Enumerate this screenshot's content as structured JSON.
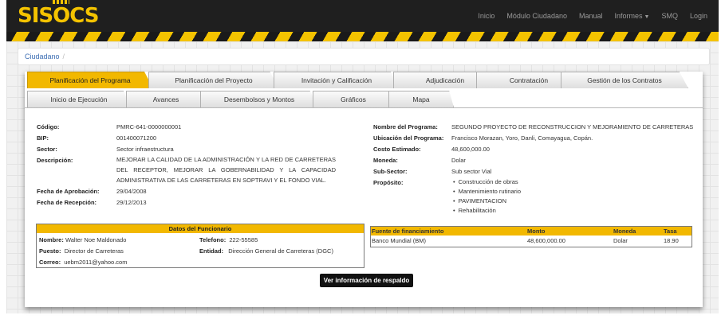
{
  "brand": {
    "logo": "SISOCS"
  },
  "nav": {
    "items": [
      "Inicio",
      "Módulo Ciudadano",
      "Manual",
      "Informes",
      "SMQ",
      "Login"
    ]
  },
  "breadcrumb": {
    "link": "Ciudadano",
    "separator": "/"
  },
  "tabs": {
    "row1": [
      "Planificación del Programa",
      "Planificación del Proyecto",
      "Invitación y Calificación",
      "Adjudicación",
      "Contratación",
      "Gestión de los Contratos"
    ],
    "row2": [
      "Inicio de Ejecución",
      "Avances",
      "Desembolsos y Montos",
      "Gráficos",
      "Mapa"
    ],
    "active": "Planificación del Programa"
  },
  "program": {
    "codigo_label": "Código:",
    "codigo": "PMRC-641-0000000001",
    "bip_label": "BIP:",
    "bip": "001400071200",
    "sector_label": "Sector:",
    "sector": "Sector infraestructura",
    "descripcion_label": "Descripción:",
    "descripcion": "MEJORAR LA CALIDAD DE LA ADMINISTRACIÓN Y LA RED DE CARRETERAS DEL RECEPTOR, MEJORAR LA GOBERNABILIDAD Y LA CAPACIDAD ADMINISTRATIVA DE LAS CARRETERAS EN SOPTRAVI Y EL FONDO VIAL.",
    "fecha_aprobacion_label": "Fecha de Aprobación:",
    "fecha_aprobacion": "29/04/2008",
    "fecha_recepcion_label": "Fecha de Recepción:",
    "fecha_recepcion": "29/12/2013",
    "nombre_label": "Nombre del Programa:",
    "nombre": "SEGUNDO PROYECTO DE RECONSTRUCCION Y MEJORAMIENTO DE CARRETERAS",
    "ubicacion_label": "Ubicación del Programa:",
    "ubicacion": "Francisco Morazan, Yoro, Danli, Comayagua, Copán.",
    "costo_label": "Costo Estimado:",
    "costo": "48,600,000.00",
    "moneda_label": "Moneda:",
    "moneda": "Dolar",
    "subsector_label": "Sub-Sector:",
    "subsector": "Sub sector Vial",
    "proposito_label": "Propósito:",
    "proposito": [
      "Construcción de obras",
      "Mantenimiento rutinario",
      "PAVIMENTACION",
      "Rehabilitación"
    ]
  },
  "funcionario": {
    "header": "Datos del Funcionario",
    "nombre_label": "Nombre:",
    "nombre": "Walter Noe Maldonado",
    "telefono_label": "Telefono:",
    "telefono": "222-55585",
    "puesto_label": "Puesto:",
    "puesto": "Director de Carreteras",
    "entidad_label": "Entidad:",
    "entidad": "Dirección General de Carreteras (DGC)",
    "correo_label": "Correo:",
    "correo": "uebm2011@yahoo.com"
  },
  "financiamiento": {
    "headers": {
      "fuente": "Fuente de financiamiento",
      "monto": "Monto",
      "moneda": "Moneda",
      "tasa": "Tasa"
    },
    "row": {
      "fuente": "Banco Mundial (BM)",
      "monto": "48,600,000.00",
      "moneda": "Dolar",
      "tasa": "18.90"
    }
  },
  "button": {
    "label": "Ver información de respaldo"
  },
  "colors": {
    "accent": "#f2b800",
    "navbar": "#1f1f1f",
    "link": "#3b6db3"
  }
}
